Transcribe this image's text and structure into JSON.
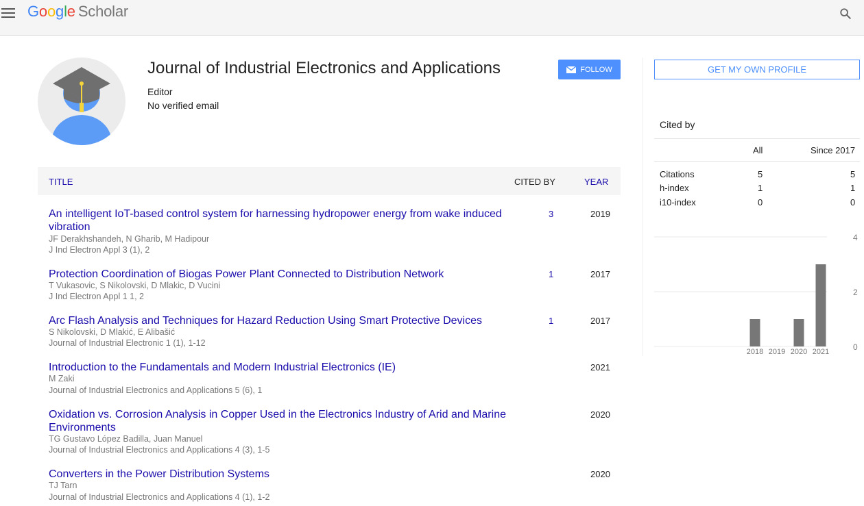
{
  "header": {
    "logo_g1": "G",
    "logo_o1": "o",
    "logo_o2": "o",
    "logo_g2": "g",
    "logo_l": "l",
    "logo_e": "e",
    "logo_scholar": "Scholar",
    "menu_icon": "hamburger-menu-icon",
    "search_icon": "search-icon"
  },
  "profile": {
    "name": "Journal of Industrial Electronics and Applications",
    "affiliation": "Editor",
    "email": "No verified email",
    "follow_label": "FOLLOW",
    "follow_icon": "envelope-icon",
    "avatar_icon": "graduation-cap-avatar-icon"
  },
  "table": {
    "headers": {
      "title": "TITLE",
      "cited_by": "CITED BY",
      "year": "YEAR"
    },
    "rows": [
      {
        "title": "An intelligent IoT-based control system for harnessing hydropower energy from wake induced vibration",
        "authors": "JF Derakhshandeh, N Gharib, M Hadipour",
        "venue": "J Ind Electron Appl 3 (1), 2",
        "cited_by": "3",
        "year": "2019"
      },
      {
        "title": "Protection Coordination of Biogas Power Plant Connected to Distribution Network",
        "authors": "T Vukasovic, S Nikolovski, D Mlakic, D Vucini",
        "venue": "J Ind Electron Appl 1 1, 2",
        "cited_by": "1",
        "year": "2017"
      },
      {
        "title": "Arc Flash Analysis and Techniques for Hazard Reduction Using Smart Protective Devices",
        "authors": "S Nikolovski, D Mlakić, E Alibašić",
        "venue": "Journal of Industrial Electronic 1 (1), 1-12",
        "cited_by": "1",
        "year": "2017"
      },
      {
        "title": "Introduction to the Fundamentals and Modern Industrial Electronics (IE)",
        "authors": "M Zaki",
        "venue": "Journal of Industrial Electronics and Applications 5 (6), 1",
        "cited_by": "",
        "year": "2021"
      },
      {
        "title": "Oxidation vs. Corrosion Analysis in Copper Used in the Electronics Industry of Arid and Marine Environments",
        "authors": "TG Gustavo López Badilla, Juan Manuel",
        "venue": "Journal of Industrial Electronics and Applications 4 (3), 1-5",
        "cited_by": "",
        "year": "2020"
      },
      {
        "title": "Converters in the Power Distribution Systems",
        "authors": "TJ Tarn",
        "venue": "Journal of Industrial Electronics and Applications 4 (1), 1-2",
        "cited_by": "",
        "year": "2020"
      }
    ]
  },
  "sidebar": {
    "own_profile_label": "GET MY OWN PROFILE",
    "cited_by_heading": "Cited by",
    "col_all": "All",
    "col_since": "Since 2017",
    "stats": [
      {
        "label": "Citations",
        "all": "5",
        "since": "5"
      },
      {
        "label": "h-index",
        "all": "1",
        "since": "1"
      },
      {
        "label": "i10-index",
        "all": "0",
        "since": "0"
      }
    ]
  },
  "chart_data": {
    "type": "bar",
    "categories": [
      "2018",
      "2019",
      "2020",
      "2021"
    ],
    "values": [
      1,
      0,
      1,
      3
    ],
    "ylim": [
      0,
      4
    ],
    "yticks": [
      "0",
      "2",
      "4"
    ],
    "bar_color": "#777777",
    "grid": true
  },
  "colors": {
    "link": "#1a0dab",
    "accent_blue": "#4d90fe",
    "avatar_blue": "#5c9cf6",
    "cap_gray": "#6f6f6f",
    "tassel_yellow": "#f5d33b"
  }
}
